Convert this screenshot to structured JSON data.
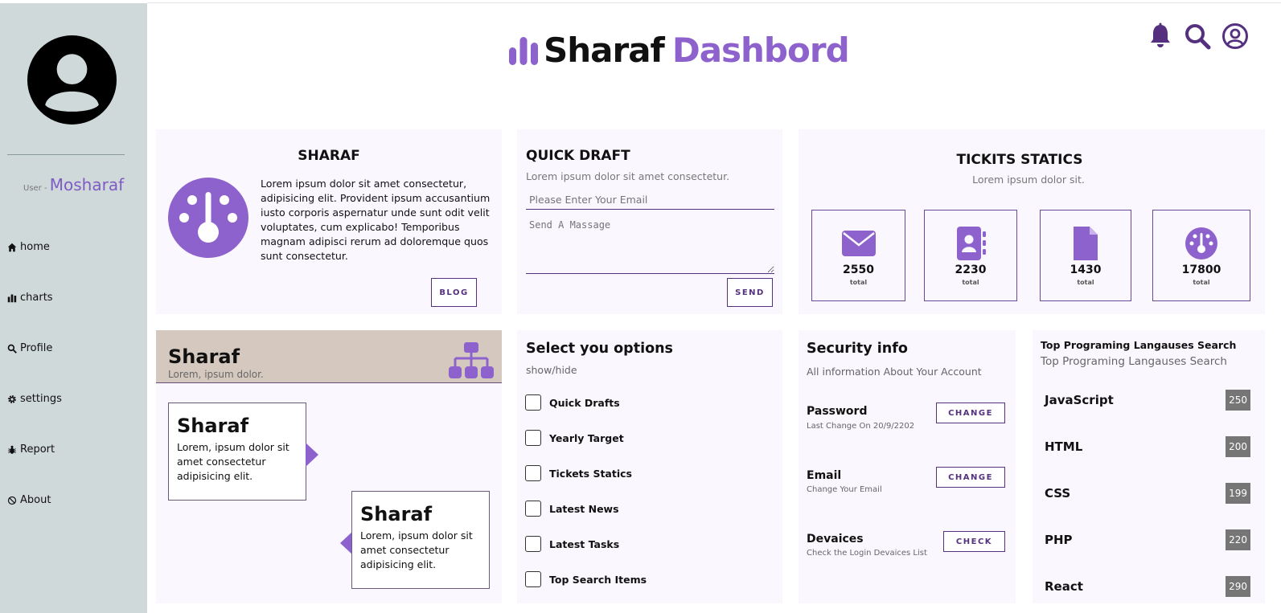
{
  "sidebar": {
    "user_prefix": "User - ",
    "user_name": "Mosharaf",
    "items": [
      {
        "label": "home",
        "icon": "home-icon"
      },
      {
        "label": "charts",
        "icon": "chart-bars-icon"
      },
      {
        "label": "Profile",
        "icon": "search-icon"
      },
      {
        "label": "settings",
        "icon": "gear-icon"
      },
      {
        "label": "Report",
        "icon": "bug-icon"
      },
      {
        "label": "About",
        "icon": "ban-icon"
      }
    ]
  },
  "header": {
    "brand_first": "Sharaf",
    "brand_second": "Dashbord",
    "icons": [
      "bell-icon",
      "search-icon",
      "user-circle-icon"
    ]
  },
  "about_card": {
    "title": "SHARAF",
    "text": "Lorem ipsum dolor sit amet consectetur, adipisicing elit. Provident ipsum accusantium iusto corporis aspernatur unde sunt odit velit voluptates, cum explicabo! Temporibus magnam adipisci rerum ad doloremque quos sunt consectetur.",
    "button": "BLOG"
  },
  "quick_draft": {
    "title": "QUICK DRAFT",
    "subtitle": "Lorem ipsum dolor sit amet consectetur.",
    "email_placeholder": "Please Enter Your Email",
    "message_placeholder": "Send A Massage",
    "button": "SEND"
  },
  "tickets": {
    "title": "TICKITS STATICS",
    "subtitle": "Lorem ipsum dolor sit.",
    "items": [
      {
        "value": "2550",
        "label": "total",
        "icon": "envelope-icon"
      },
      {
        "value": "2230",
        "label": "total",
        "icon": "contact-book-icon"
      },
      {
        "value": "1430",
        "label": "total",
        "icon": "file-icon"
      },
      {
        "value": "17800",
        "label": "total",
        "icon": "gauge-icon"
      }
    ]
  },
  "timeline": {
    "title": "Sharaf",
    "subtitle": "Lorem, ipsum dolor.",
    "cards": [
      {
        "title": "Sharaf",
        "text": "Lorem, ipsum dolor sit amet consectetur adipisicing elit."
      },
      {
        "title": "Sharaf",
        "text": "Lorem, ipsum dolor sit amet consectetur adipisicing elit."
      }
    ]
  },
  "options": {
    "title": "Select you options",
    "subtitle": "show/hide",
    "items": [
      "Quick Drafts",
      "Yearly Target",
      "Tickets Statics",
      "Latest News",
      "Latest Tasks",
      "Top Search Items"
    ]
  },
  "security": {
    "title": "Security info",
    "subtitle": "All information About Your Account",
    "items": [
      {
        "title": "Password",
        "desc": "Last Change On 20/9/2202",
        "button": "CHANGE"
      },
      {
        "title": "Email",
        "desc": "Change Your Email",
        "button": "CHANGE"
      },
      {
        "title": "Devaices",
        "desc": "Check the Login Devaices List",
        "button": "CHECK"
      }
    ]
  },
  "top_search": {
    "title": "Top Programing Langauses Search",
    "subtitle": "Top Programing Langauses Search",
    "items": [
      {
        "name": "JavaScript",
        "count": "250"
      },
      {
        "name": "HTML",
        "count": "200"
      },
      {
        "name": "CSS",
        "count": "199"
      },
      {
        "name": "PHP",
        "count": "220"
      },
      {
        "name": "React",
        "count": "290"
      }
    ]
  },
  "colors": {
    "accent": "#8d62cc",
    "dark_accent": "#55307f",
    "sidebar": "#d0d9d9",
    "panel": "#fbf7ff",
    "timeline_header": "#d5c9bf"
  }
}
